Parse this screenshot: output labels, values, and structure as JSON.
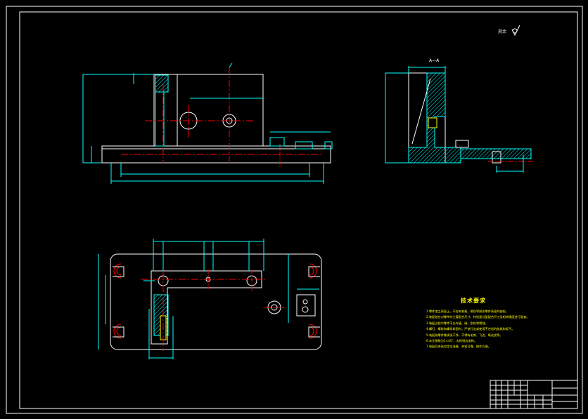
{
  "drawing": {
    "section_label": "A—A",
    "roughness_note": "其余",
    "technical_requirements": {
      "title": "技术要求",
      "items": [
        "1.零件加工表面上，不应有划痕、擦伤等损伤零件表面的缺陷。",
        "2.装配前应对零件的主要配合尺寸，特别是过盈配合尺寸及相关精度进行复查。",
        "3.装配过程中零件不允许磕、碰、划伤和锈蚀。",
        "4.螺钉、螺栓和螺母紧固时，严禁打击或使用不合适的旋具和扳手。",
        "5.装配前零件需清洗干净，不得有毛刺、飞边、氧化皮等。",
        "6.未注倒角为1×45°，去除锐边毛刺。",
        "7.装配后夹具应定位准确、夹紧可靠、操作方便。"
      ]
    },
    "colors": {
      "background": "#000000",
      "frame": "#ffffff",
      "outline": "#ffffff",
      "hatch": "#00ffff",
      "centerline": "#ff0000",
      "dimension": "#00ffff",
      "annotation_text": "#ffff00"
    }
  }
}
